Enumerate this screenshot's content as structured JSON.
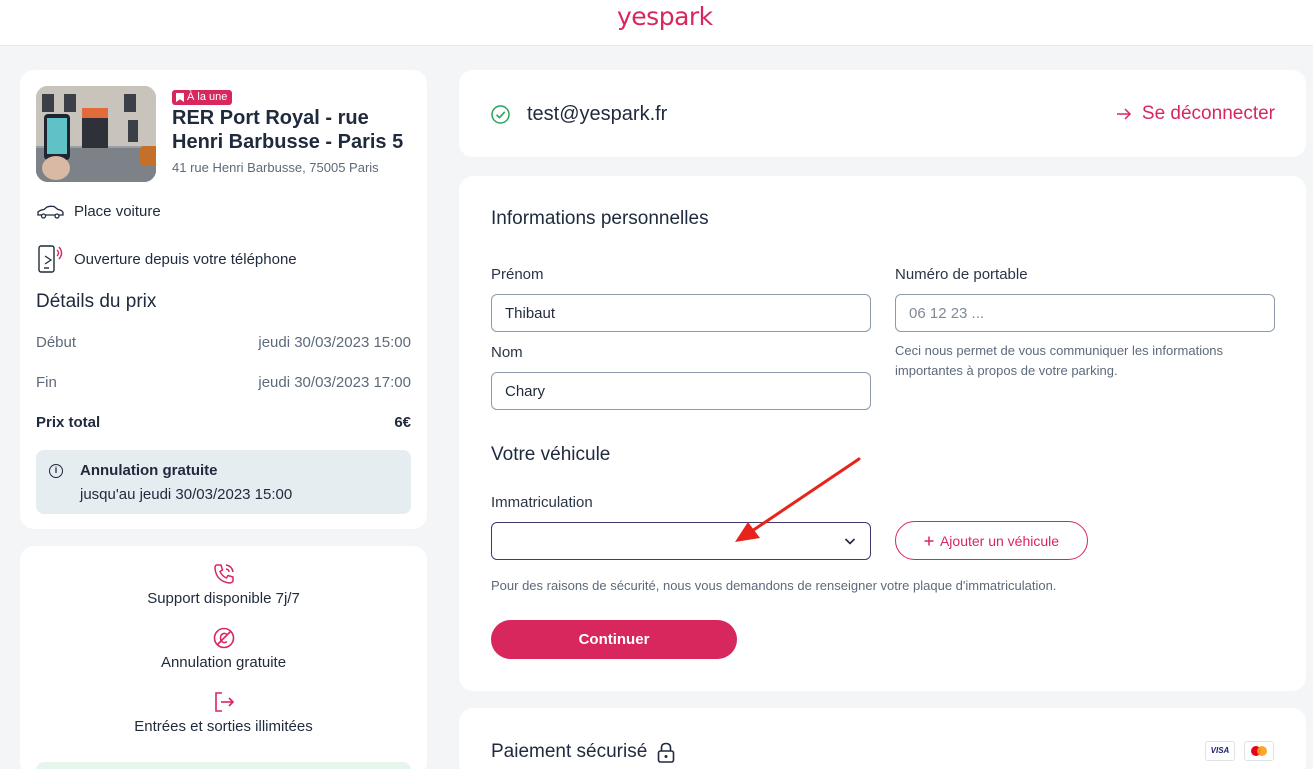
{
  "brand": {
    "logo": "yespark",
    "accent_color": "#d8275d"
  },
  "parking": {
    "badge": "À la une",
    "title": "RER Port Royal - rue Henri Barbusse - Paris 5",
    "address": "41 rue Henri Barbusse, 75005 Paris",
    "features": [
      "Place voiture",
      "Ouverture depuis votre téléphone"
    ]
  },
  "price_details": {
    "heading": "Détails du prix",
    "rows": [
      {
        "label": "Début",
        "value": "jeudi 30/03/2023 15:00"
      },
      {
        "label": "Fin",
        "value": "jeudi 30/03/2023 17:00"
      },
      {
        "label": "Prix total",
        "value": "6€"
      }
    ],
    "cancellation": {
      "title": "Annulation gratuite",
      "subtitle": "jusqu'au jeudi 30/03/2023 15:00"
    }
  },
  "perks": [
    "Support disponible 7j/7",
    "Annulation gratuite",
    "Entrées et sorties illimitées"
  ],
  "account": {
    "email": "test@yespark.fr",
    "logout_label": "Se déconnecter"
  },
  "personal_info": {
    "title": "Informations personnelles",
    "first_name_label": "Prénom",
    "first_name_value": "Thibaut",
    "last_name_label": "Nom",
    "last_name_value": "Chary",
    "phone_label": "Numéro de portable",
    "phone_placeholder": "06 12 23 ...",
    "phone_help": "Ceci nous permet de vous communiquer les informations importantes à propos de votre parking."
  },
  "vehicle": {
    "title": "Votre véhicule",
    "plate_label": "Immatriculation",
    "plate_value": "",
    "add_button": "Ajouter un véhicule",
    "help": "Pour des raisons de sécurité, nous vous demandons de renseigner votre plaque d'immatriculation.",
    "continue_label": "Continuer"
  },
  "payment": {
    "title": "Paiement sécurisé",
    "cards": [
      "VISA",
      "Mastercard"
    ]
  },
  "icons": [
    "car-icon",
    "phone-unlock-icon",
    "info-icon",
    "phone-support-icon",
    "no-fee-icon",
    "exit-icon",
    "check-circle-icon",
    "arrow-right-icon",
    "chevron-down-icon",
    "plus-icon",
    "lock-icon",
    "bookmark-icon"
  ],
  "annotation": {
    "arrow_color": "#e8231c"
  }
}
